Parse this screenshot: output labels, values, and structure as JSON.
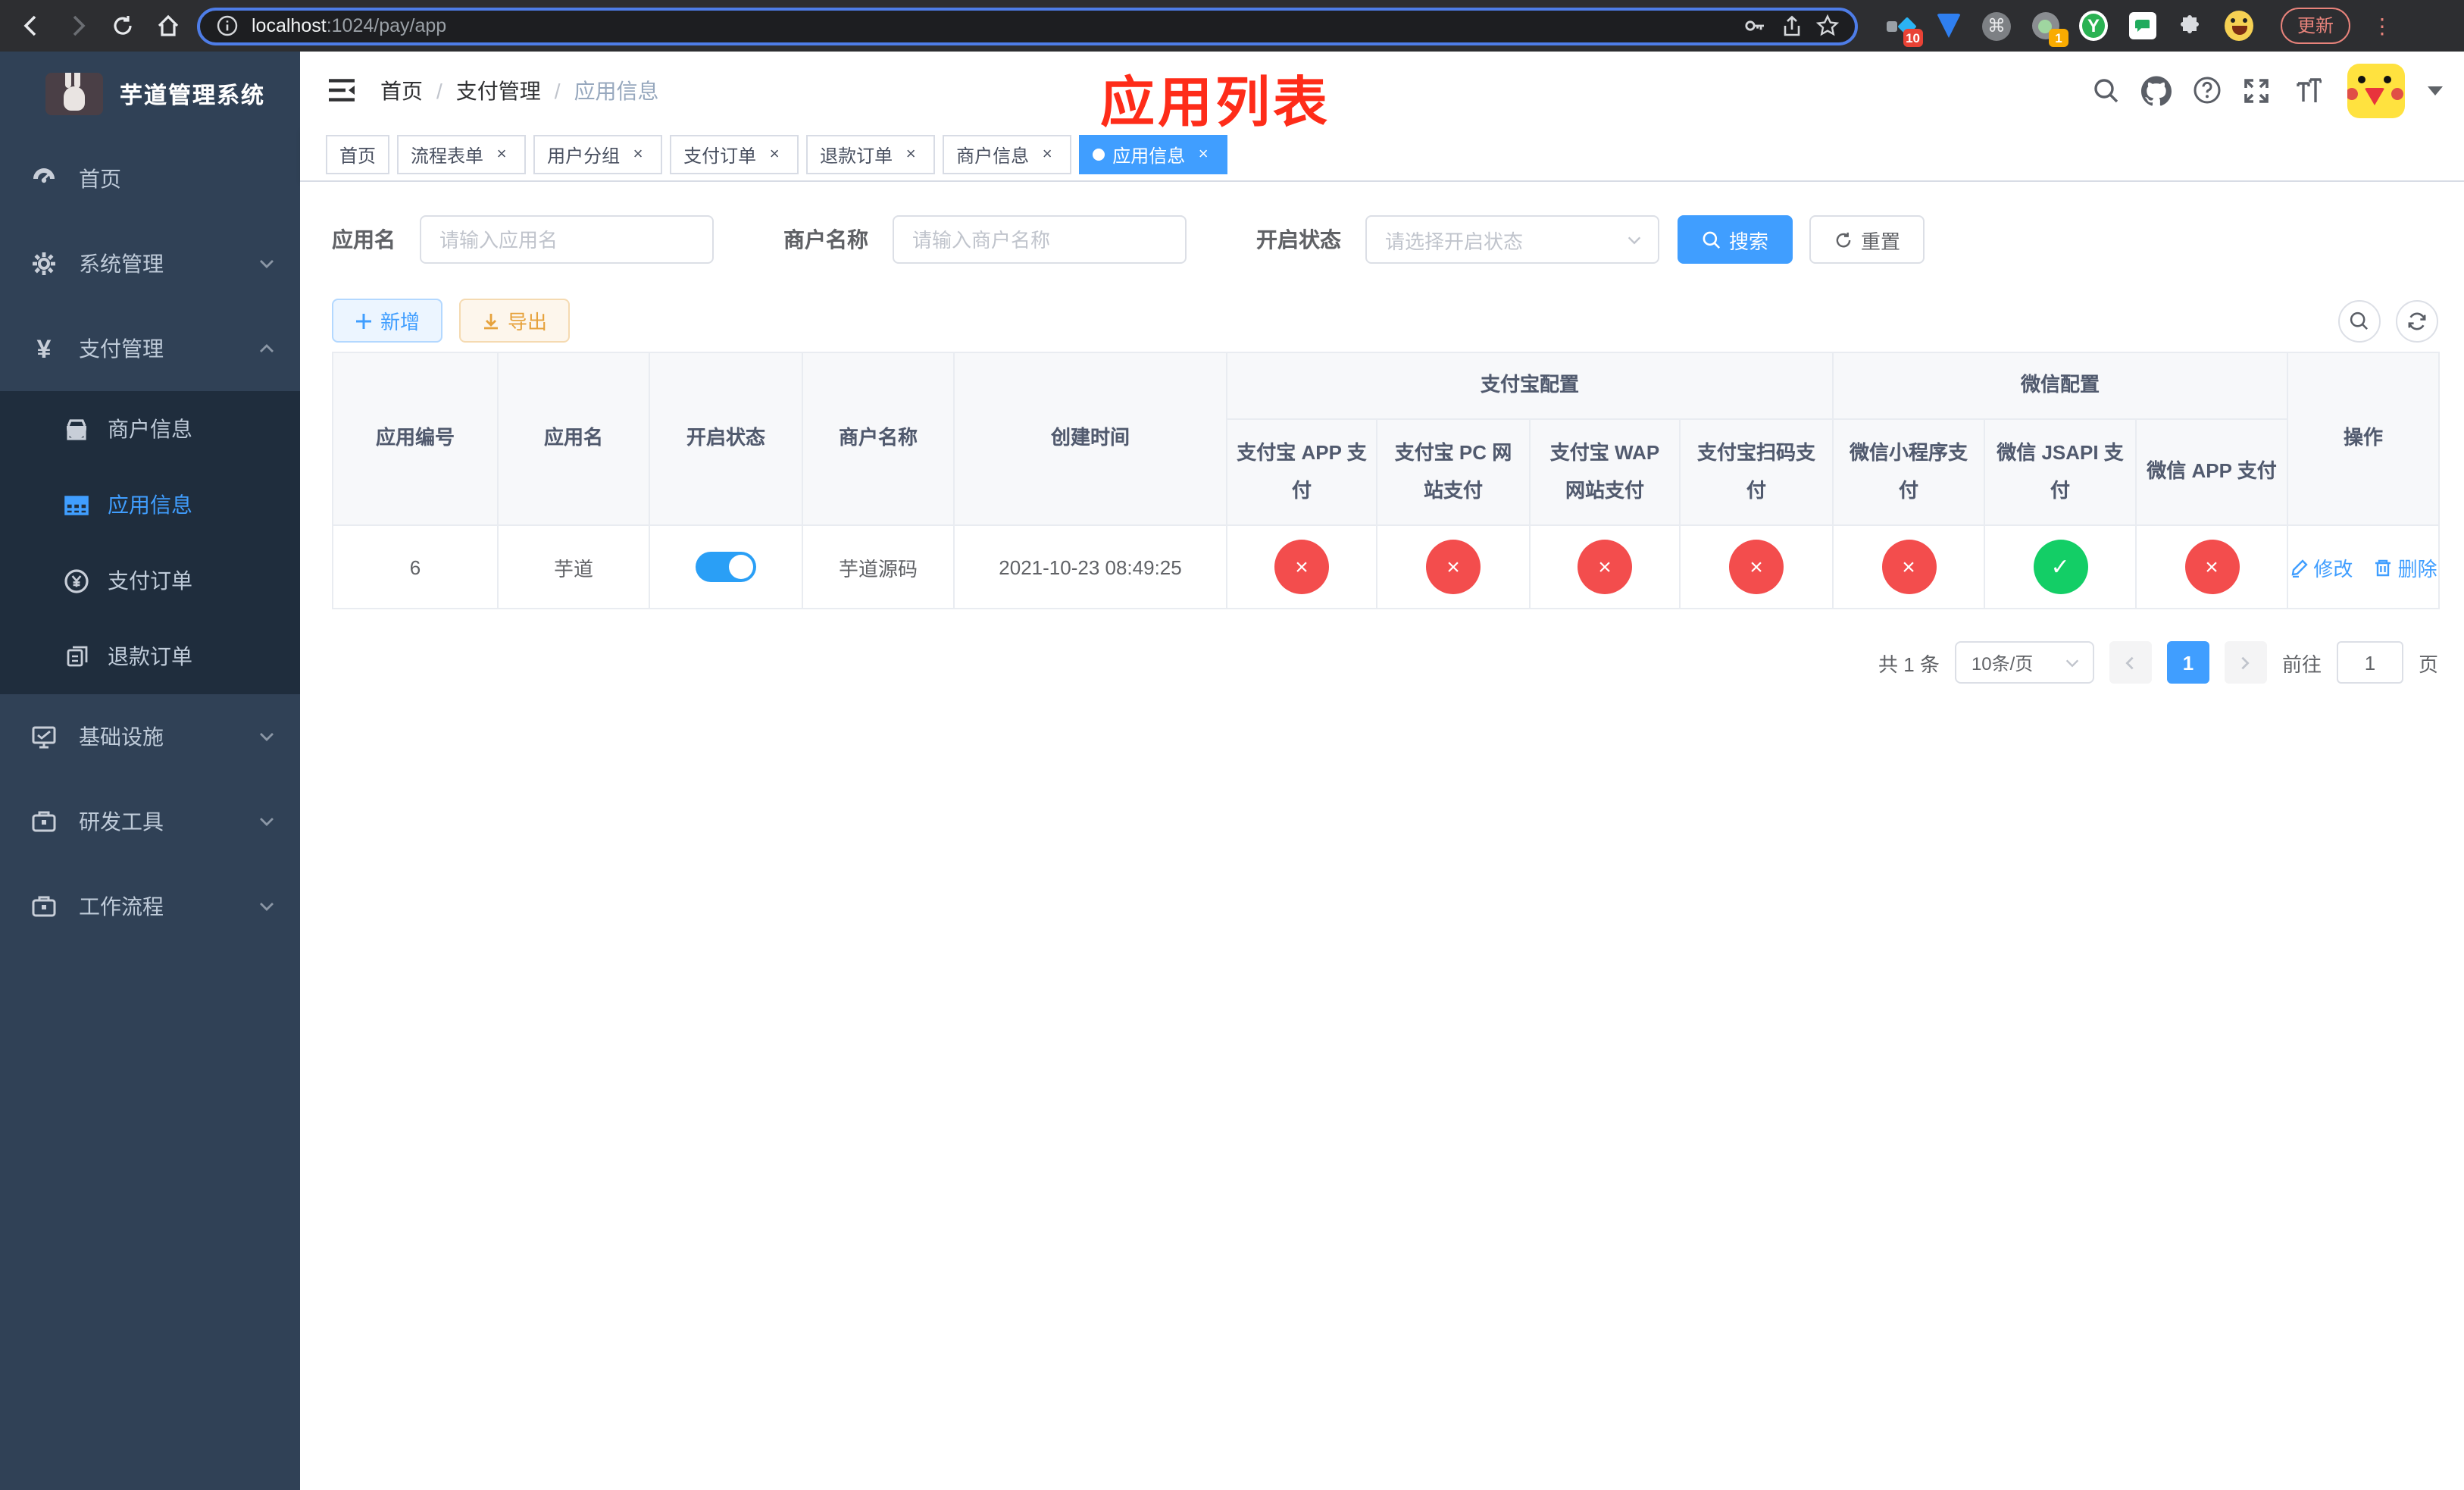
{
  "browser": {
    "url_host": "localhost",
    "url_rest": ":1024/pay/app",
    "update_label": "更新",
    "ext_badge_1": "10",
    "ext_badge_2": "1",
    "ext_y_label": "Y",
    "cmd_glyph": "⌘",
    "kebab_glyph": "⋮"
  },
  "sidebar": {
    "title": "芋道管理系统",
    "items": [
      {
        "label": "首页"
      },
      {
        "label": "系统管理"
      },
      {
        "label": "支付管理"
      },
      {
        "label": "基础设施"
      },
      {
        "label": "研发工具"
      },
      {
        "label": "工作流程"
      }
    ],
    "submenu": [
      {
        "label": "商户信息"
      },
      {
        "label": "应用信息",
        "active": true
      },
      {
        "label": "支付订单"
      },
      {
        "label": "退款订单"
      }
    ]
  },
  "header": {
    "breadcrumb": [
      "首页",
      "支付管理",
      "应用信息"
    ],
    "separator": "/",
    "annotation": "应用列表"
  },
  "tabs": [
    {
      "label": "首页",
      "closable": false,
      "active": false
    },
    {
      "label": "流程表单",
      "closable": true,
      "active": false
    },
    {
      "label": "用户分组",
      "closable": true,
      "active": false
    },
    {
      "label": "支付订单",
      "closable": true,
      "active": false
    },
    {
      "label": "退款订单",
      "closable": true,
      "active": false
    },
    {
      "label": "商户信息",
      "closable": true,
      "active": false
    },
    {
      "label": "应用信息",
      "closable": true,
      "active": true
    }
  ],
  "filters": {
    "app_name_label": "应用名",
    "app_name_placeholder": "请输入应用名",
    "merchant_label": "商户名称",
    "merchant_placeholder": "请输入商户名称",
    "status_label": "开启状态",
    "status_placeholder": "请选择开启状态",
    "search_label": "搜索",
    "reset_label": "重置"
  },
  "toolbar": {
    "add_label": "新增",
    "export_label": "导出"
  },
  "table": {
    "columns": [
      "应用编号",
      "应用名",
      "开启状态",
      "商户名称",
      "创建时间"
    ],
    "groups": [
      {
        "label": "支付宝配置",
        "children": [
          "支付宝 APP 支付",
          "支付宝 PC 网站支付",
          "支付宝 WAP 网站支付",
          "支付宝扫码支付"
        ]
      },
      {
        "label": "微信配置",
        "children": [
          "微信小程序支付",
          "微信 JSAPI 支付",
          "微信 APP 支付"
        ]
      }
    ],
    "action_column": "操作",
    "row": {
      "id": "6",
      "name": "芋道",
      "status_on": true,
      "merchant": "芋道源码",
      "created": "2021-10-23 08:49:25",
      "channels": [
        false,
        false,
        false,
        false,
        false,
        true,
        false
      ],
      "edit_label": "修改",
      "delete_label": "删除"
    }
  },
  "pagination": {
    "total": "共 1 条",
    "page_size": "10条/页",
    "current": "1",
    "goto_prefix": "前往",
    "goto_value": "1",
    "goto_suffix": "页"
  },
  "colors": {
    "primary": "#409EFF",
    "danger": "#f34d4d",
    "success": "#13ce66",
    "annotation_red": "#fe2c19",
    "sidebar_bg": "#304156",
    "submenu_bg": "#1f2d3d"
  }
}
